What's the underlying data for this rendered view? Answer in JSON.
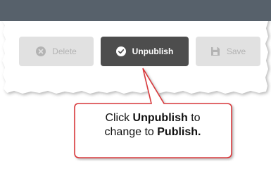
{
  "toolbar": {
    "delete_label": "Delete",
    "delete_icon": "x-circle-icon",
    "unpublish_label": "Unpublish",
    "unpublish_icon": "check-circle-icon",
    "save_label": "Save",
    "save_icon": "floppy-disk-icon"
  },
  "callout": {
    "line1_prefix": "Click ",
    "line1_bold": "Unpublish",
    "line1_suffix": " to",
    "line2_prefix": "change to ",
    "line2_bold": "Publish."
  },
  "colors": {
    "header_bar": "#57616b",
    "active_button": "#4d4d4d",
    "disabled_button": "#e1e1e1",
    "callout_border": "#d9383a"
  }
}
